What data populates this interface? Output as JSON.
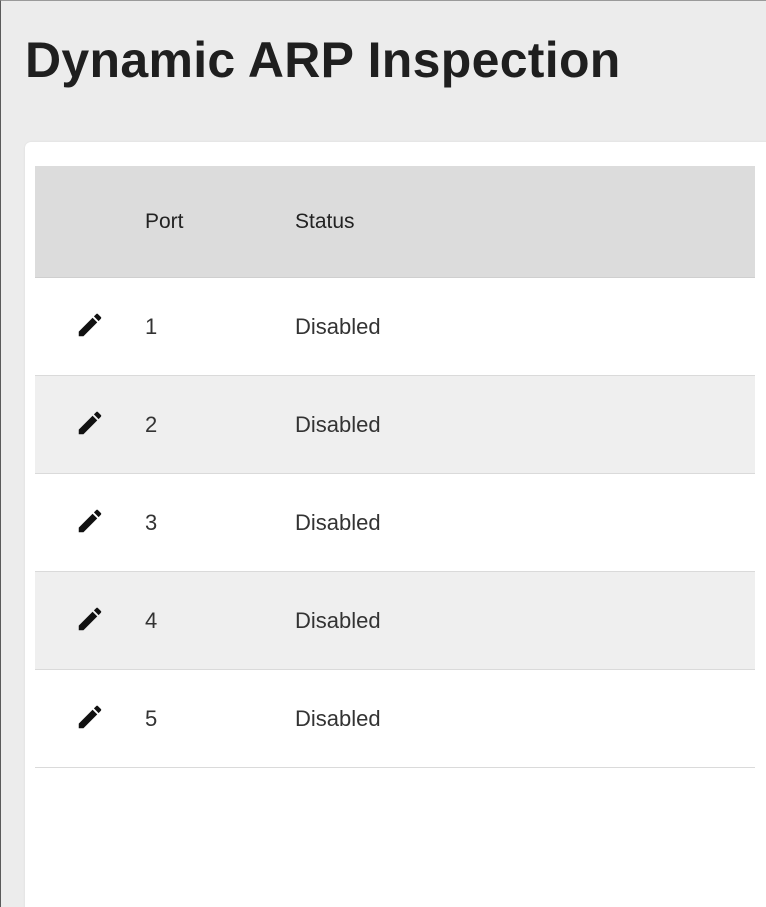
{
  "page": {
    "title": "Dynamic ARP Inspection"
  },
  "table": {
    "columns": {
      "edit": "",
      "port": "Port",
      "status": "Status"
    },
    "rows": [
      {
        "port": "1",
        "status": "Disabled",
        "edit_icon": "pencil-icon"
      },
      {
        "port": "2",
        "status": "Disabled",
        "edit_icon": "pencil-icon"
      },
      {
        "port": "3",
        "status": "Disabled",
        "edit_icon": "pencil-icon"
      },
      {
        "port": "4",
        "status": "Disabled",
        "edit_icon": "pencil-icon"
      },
      {
        "port": "5",
        "status": "Disabled",
        "edit_icon": "pencil-icon"
      }
    ]
  },
  "colors": {
    "page_background": "#ececec",
    "card_background": "#ffffff",
    "header_background": "#dcdcdc",
    "alt_row_background": "#efefef",
    "icon_color": "#111111"
  }
}
